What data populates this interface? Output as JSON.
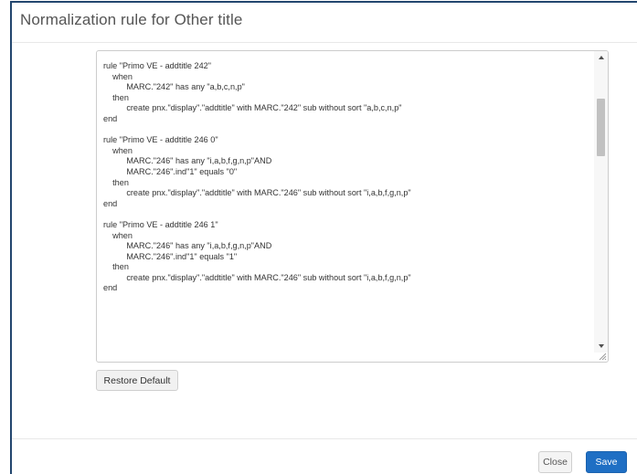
{
  "modal": {
    "title": "Normalization rule for Other title"
  },
  "editor": {
    "code": "rule \"Primo VE - addtitle 242\"\n    when\n          MARC.\"242\" has any \"a,b,c,n,p\"\n    then\n          create pnx.\"display\".\"addtitle\" with MARC.\"242\" sub without sort \"a,b,c,n,p\"\nend\n\nrule \"Primo VE - addtitle 246 0\"\n    when\n          MARC.\"246\" has any \"i,a,b,f,g,n,p\"AND\n          MARC.\"246\".ind\"1\" equals \"0\"\n    then\n          create pnx.\"display\".\"addtitle\" with MARC.\"246\" sub without sort \"i,a,b,f,g,n,p\"\nend\n\nrule \"Primo VE - addtitle 246 1\"\n    when\n          MARC.\"246\" has any \"i,a,b,f,g,n,p\"AND\n          MARC.\"246\".ind\"1\" equals \"1\"\n    then\n          create pnx.\"display\".\"addtitle\" with MARC.\"246\" sub without sort \"i,a,b,f,g,n,p\"\nend"
  },
  "buttons": {
    "restore_default": "Restore Default",
    "close": "Close",
    "save": "Save"
  },
  "icons": {
    "scroll_up": "scroll-up-arrow-icon",
    "scroll_down": "scroll-down-arrow-icon",
    "resize": "resize-grip-icon"
  },
  "colors": {
    "frame_border": "#22466e",
    "primary_button": "#1f6fc4",
    "title_text": "#555555"
  }
}
